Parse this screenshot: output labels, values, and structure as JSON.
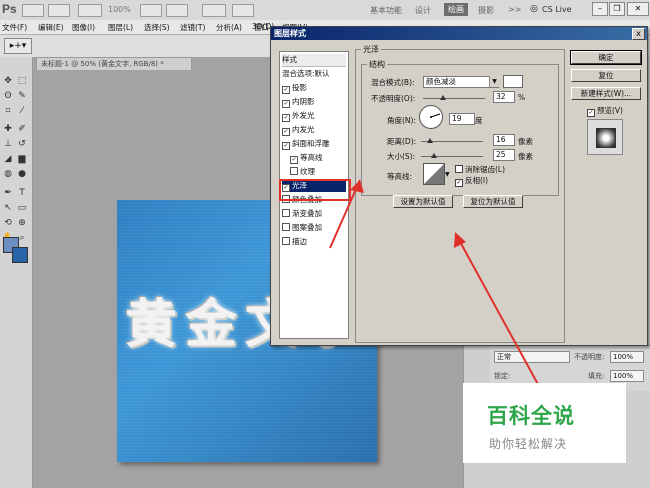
{
  "appbar": {
    "logo": "Ps",
    "zoom": "100%",
    "workspaces": [
      "基本功能",
      "设计",
      "绘画",
      "摄影",
      ">>"
    ],
    "cslive": "CS Live"
  },
  "menu": [
    "文件(F)",
    "编辑(E)",
    "图像(I)",
    "图层(L)",
    "选择(S)",
    "滤镜(T)",
    "分析(A)",
    "3D(D)",
    "视图(V)",
    "窗口"
  ],
  "doc_tab": "未标题-1 @ 50% (黄金文字, RGB/8) *",
  "canvas_text": "黄金文字",
  "layers_panel": {
    "blend": "正常",
    "opacity_label": "不透明度:",
    "opacity": "100%",
    "lock_label": "锁定:",
    "fill_label": "填充:",
    "fill": "100%"
  },
  "dialog": {
    "title": "图层样式",
    "close": "x",
    "style_header": "样式",
    "blend_options": "混合选项:默认",
    "styles": [
      {
        "label": "投影",
        "checked": true
      },
      {
        "label": "内阴影",
        "checked": true
      },
      {
        "label": "外发光",
        "checked": true
      },
      {
        "label": "内发光",
        "checked": true
      },
      {
        "label": "斜面和浮雕",
        "checked": true
      },
      {
        "label": "等高线",
        "checked": true
      },
      {
        "label": "纹理",
        "checked": false
      },
      {
        "label": "光泽",
        "checked": true
      },
      {
        "label": "颜色叠加",
        "checked": false
      },
      {
        "label": "渐变叠加",
        "checked": false
      },
      {
        "label": "图案叠加",
        "checked": false
      },
      {
        "label": "描边",
        "checked": false
      }
    ],
    "group_title": "光泽",
    "sub_title": "结构",
    "blend_mode_label": "混合模式(B):",
    "blend_mode": "颜色减淡",
    "opacity_label": "不透明度(O):",
    "opacity_value": "32",
    "opacity_unit": "%",
    "opacity_level": 0.32,
    "angle_label": "角度(N):",
    "angle_value": "19",
    "angle_unit": "度",
    "distance_label": "距离(D):",
    "distance_value": "16",
    "distance_unit": "像素",
    "size_label": "大小(S):",
    "size_value": "25",
    "size_unit": "像素",
    "contour_label": "等高线:",
    "antialias_label": "消除锯齿(L)",
    "invert_label": "反相(I)",
    "set_default": "设置为默认值",
    "reset_default": "复位为默认值",
    "ok": "确定",
    "reset": "复位",
    "new_style": "新建样式(W)...",
    "preview": "预览(V)"
  },
  "watermark": {
    "title": "百科全说",
    "subtitle": "助你轻松解决"
  },
  "colors": {
    "accent_red": "#e0302a",
    "watermark_green": "#2fa64a",
    "selection": "#0a246a"
  }
}
